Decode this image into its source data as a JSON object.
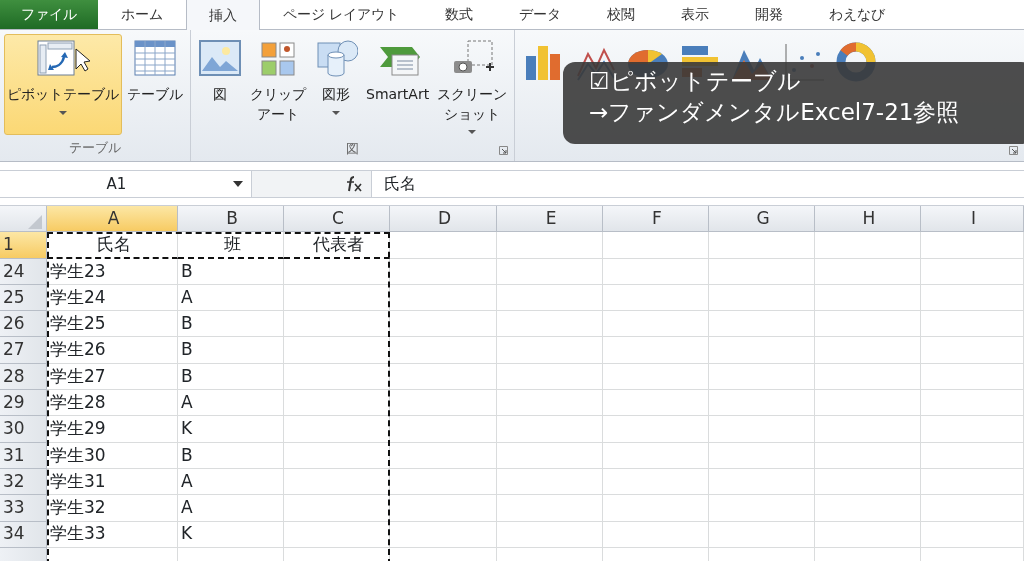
{
  "ribbon_tabs": [
    {
      "label": "ファイル",
      "kind": "file",
      "selected": false
    },
    {
      "label": "ホーム",
      "kind": "tab",
      "selected": false
    },
    {
      "label": "挿入",
      "kind": "tab",
      "selected": true
    },
    {
      "label": "ページ レイアウト",
      "kind": "tab",
      "selected": false
    },
    {
      "label": "数式",
      "kind": "tab",
      "selected": false
    },
    {
      "label": "データ",
      "kind": "tab",
      "selected": false
    },
    {
      "label": "校閲",
      "kind": "tab",
      "selected": false
    },
    {
      "label": "表示",
      "kind": "tab",
      "selected": false
    },
    {
      "label": "開発",
      "kind": "tab",
      "selected": false
    },
    {
      "label": "わえなび",
      "kind": "tab",
      "selected": false
    }
  ],
  "ribbon_groups": [
    {
      "label": "テーブル",
      "launcher": false,
      "buttons": [
        {
          "lines": [
            "ピボットテーブル"
          ],
          "kind": "pivot",
          "dropdown": true,
          "selected": true
        },
        {
          "lines": [
            "テーブル"
          ],
          "kind": "table",
          "dropdown": false,
          "selected": false
        }
      ]
    },
    {
      "label": "図",
      "launcher": true,
      "buttons": [
        {
          "lines": [
            "図"
          ],
          "kind": "picture",
          "dropdown": false,
          "selected": false
        },
        {
          "lines": [
            "クリップ",
            "アート"
          ],
          "kind": "clipart",
          "dropdown": false,
          "selected": false
        },
        {
          "lines": [
            "図形"
          ],
          "kind": "shapes",
          "dropdown": true,
          "selected": false
        },
        {
          "lines": [
            "SmartArt"
          ],
          "kind": "smartart",
          "dropdown": false,
          "selected": false
        },
        {
          "lines": [
            "スクリーン",
            "ショット"
          ],
          "kind": "screenshot",
          "dropdown": true,
          "selected": false
        }
      ]
    },
    {
      "launcher": true,
      "buttons": [
        {
          "kind": "column"
        },
        {
          "kind": "line"
        },
        {
          "kind": "pie"
        },
        {
          "kind": "bar"
        },
        {
          "kind": "area"
        },
        {
          "kind": "scatter"
        },
        {
          "kind": "donut"
        }
      ]
    }
  ],
  "name_box": {
    "value": "A1"
  },
  "formula_bar": {
    "value": "氏名"
  },
  "columns": [
    {
      "label": "A",
      "selected": true,
      "in_copy_range": true
    },
    {
      "label": "B",
      "selected": false,
      "in_copy_range": true
    },
    {
      "label": "C",
      "selected": false,
      "in_copy_range": true
    },
    {
      "label": "D",
      "selected": false,
      "in_copy_range": false
    },
    {
      "label": "E",
      "selected": false,
      "in_copy_range": false
    },
    {
      "label": "F",
      "selected": false,
      "in_copy_range": false
    },
    {
      "label": "G",
      "selected": false,
      "in_copy_range": false
    },
    {
      "label": "H",
      "selected": false,
      "in_copy_range": false
    },
    {
      "label": "I",
      "selected": false,
      "in_copy_range": false
    }
  ],
  "rows": [
    {
      "number": "1",
      "kind": "header",
      "selected": true,
      "cells": [
        "氏名",
        "班",
        "代表者"
      ]
    },
    {
      "number": "24",
      "kind": "data",
      "selected": false,
      "cells": [
        "学生23",
        "B"
      ]
    },
    {
      "number": "25",
      "kind": "data",
      "selected": false,
      "cells": [
        "学生24",
        "A"
      ]
    },
    {
      "number": "26",
      "kind": "data",
      "selected": false,
      "cells": [
        "学生25",
        "B"
      ]
    },
    {
      "number": "27",
      "kind": "data",
      "selected": false,
      "cells": [
        "学生26",
        "B"
      ]
    },
    {
      "number": "28",
      "kind": "data",
      "selected": false,
      "cells": [
        "学生27",
        "B"
      ]
    },
    {
      "number": "29",
      "kind": "data",
      "selected": false,
      "cells": [
        "学生28",
        "A"
      ]
    },
    {
      "number": "30",
      "kind": "data",
      "selected": false,
      "cells": [
        "学生29",
        "K"
      ]
    },
    {
      "number": "31",
      "kind": "data",
      "selected": false,
      "cells": [
        "学生30",
        "B"
      ]
    },
    {
      "number": "32",
      "kind": "data",
      "selected": false,
      "cells": [
        "学生31",
        "A"
      ]
    },
    {
      "number": "33",
      "kind": "data",
      "selected": false,
      "cells": [
        "学生32",
        "A"
      ]
    },
    {
      "number": "34",
      "kind": "data",
      "selected": false,
      "cells": [
        "学生33",
        "K"
      ]
    }
  ],
  "caption": {
    "lines": [
      "☑ピボットテーブル",
      "→ファンダメンタルExcel7-21参照"
    ]
  }
}
